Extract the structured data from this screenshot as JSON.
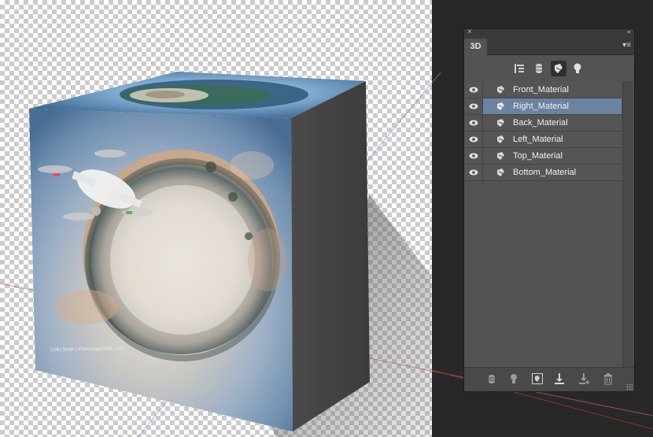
{
  "document": {
    "credit_text": "Colin Smith | PhotoshopCAFE.com"
  },
  "panel": {
    "close_glyph": "×",
    "collapse_glyph": "«",
    "tab_label": "3D",
    "menu_glyph": "▾≡",
    "filters": [
      {
        "name": "scene-filter",
        "icon": "scene-icon",
        "active": false
      },
      {
        "name": "meshes-filter",
        "icon": "mesh-icon",
        "active": false
      },
      {
        "name": "materials-filter",
        "icon": "material-icon",
        "active": true
      },
      {
        "name": "lights-filter",
        "icon": "bulb-icon",
        "active": false
      }
    ],
    "materials": [
      {
        "label": "Front_Material",
        "selected": false
      },
      {
        "label": "Right_Material",
        "selected": true
      },
      {
        "label": "Back_Material",
        "selected": false
      },
      {
        "label": "Left_Material",
        "selected": false
      },
      {
        "label": "Top_Material",
        "selected": false
      },
      {
        "label": "Bottom_Material",
        "selected": false
      }
    ],
    "bottom_tools": [
      "render-icon",
      "light-icon",
      "fit-view-icon",
      "drop-to-ground-icon",
      "new-object-icon",
      "trash-icon"
    ]
  },
  "colors": {
    "selection": "#6d82a0",
    "panel_bg": "#535353",
    "workspace_bg": "#282828"
  }
}
